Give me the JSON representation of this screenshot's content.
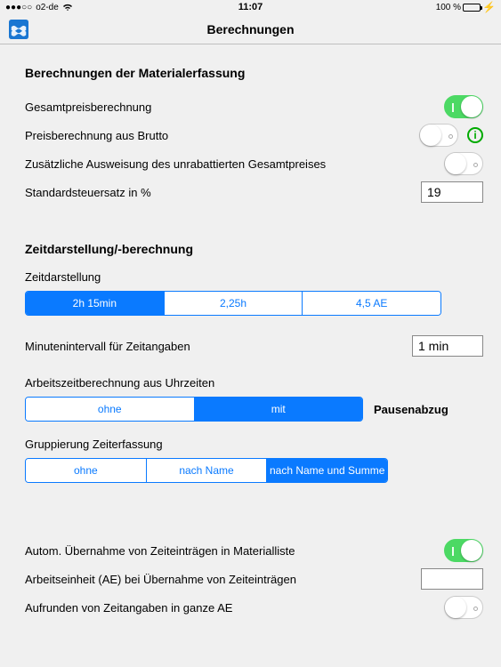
{
  "status": {
    "signal": "●●●○○",
    "carrier": "o2-de",
    "time": "11:07",
    "battery_pct": "100 %"
  },
  "header": {
    "title": "Berechnungen"
  },
  "section1": {
    "title": "Berechnungen der Materialerfassung",
    "row1_label": "Gesamtpreisberechnung",
    "row2_label": "Preisberechnung aus Brutto",
    "row3_label": "Zusätzliche Ausweisung des unrabattierten Gesamtpreises",
    "row4_label": "Standardsteuersatz in %",
    "tax_rate": "19",
    "toggle1": true,
    "toggle2": false,
    "toggle3": false
  },
  "section2": {
    "title": "Zeitdarstellung/-berechnung",
    "row_display_label": "Zeitdarstellung",
    "display_options": [
      "2h 15min",
      "2,25h",
      "4,5 AE"
    ],
    "display_selected": 0,
    "row_interval_label": "Minutenintervall für Zeitangaben",
    "interval_value": "1 min",
    "row_worktime_label": "Arbeitszeitberechnung aus Uhrzeiten",
    "worktime_options": [
      "ohne",
      "mit"
    ],
    "worktime_selected": 1,
    "worktime_aside": "Pausenabzug",
    "row_group_label": "Gruppierung Zeiterfassung",
    "group_options": [
      "ohne",
      "nach Name",
      "nach Name und Summe"
    ],
    "group_selected": 2
  },
  "section3": {
    "row1_label": "Autom. Übernahme von Zeiteinträgen in Materialliste",
    "row2_label": "Arbeitseinheit (AE) bei Übernahme von Zeiteinträgen",
    "row3_label": "Aufrunden von Zeitangaben in ganze AE",
    "ae_value": "",
    "toggle1": true,
    "toggle3": false
  }
}
